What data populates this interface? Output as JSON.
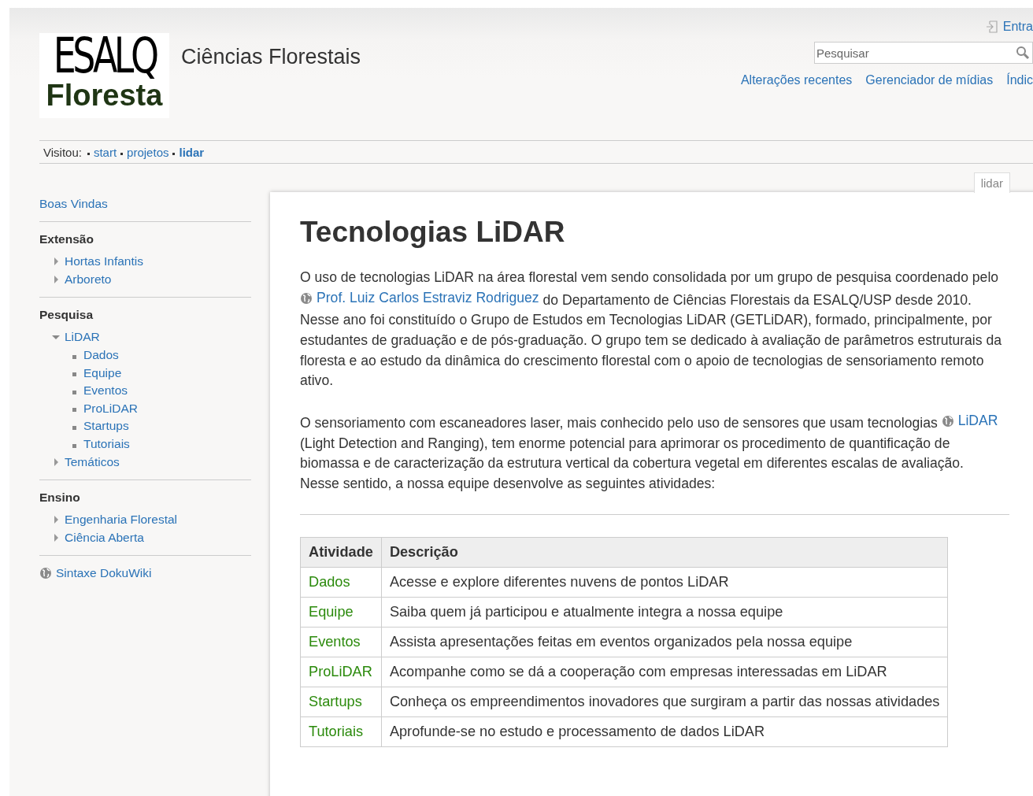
{
  "logo": {
    "line1": "ESALQ",
    "line2": "Floresta"
  },
  "site_title": "Ciências Florestais",
  "user_tools": [
    {
      "label": "Entra"
    }
  ],
  "search": {
    "placeholder": "Pesquisar"
  },
  "site_tools": [
    "Alterações recentes",
    "Gerenciador de mídias",
    "Índic"
  ],
  "breadcrumbs": {
    "label": "Visitou:",
    "items": [
      {
        "label": "start",
        "current": false
      },
      {
        "label": "projetos",
        "current": false
      },
      {
        "label": "lidar",
        "current": true
      }
    ]
  },
  "page_tab": "lidar",
  "sidebar": {
    "top_link": "Boas Vindas",
    "sections": [
      {
        "title": "Extensão",
        "items": [
          {
            "label": "Hortas Infantis",
            "expanded": false
          },
          {
            "label": "Arboreto",
            "expanded": false
          }
        ]
      },
      {
        "title": "Pesquisa",
        "items": [
          {
            "label": "LiDAR",
            "expanded": true,
            "children": [
              {
                "label": "Dados"
              },
              {
                "label": "Equipe"
              },
              {
                "label": "Eventos"
              },
              {
                "label": "ProLiDAR"
              },
              {
                "label": "Startups"
              },
              {
                "label": "Tutoriais"
              }
            ]
          },
          {
            "label": "Temáticos",
            "expanded": false
          }
        ]
      },
      {
        "title": "Ensino",
        "items": [
          {
            "label": "Engenharia Florestal",
            "expanded": false
          },
          {
            "label": "Ciência Aberta",
            "expanded": false
          }
        ]
      }
    ],
    "bottom_link": "Sintaxe DokuWiki"
  },
  "heading": "Tecnologias LiDAR",
  "paragraphs": [
    [
      {
        "kind": "text",
        "text": "O uso de tecnologias LiDAR na área florestal vem sendo consolidada por um grupo de pesquisa coordenado pelo "
      },
      {
        "kind": "external",
        "text": "Prof. Luiz Carlos Estraviz Rodriguez"
      },
      {
        "kind": "text",
        "text": " do Departamento de Ciências Florestais da ESALQ/USP desde 2010. Nesse ano foi constituído o Grupo de Estudos em Tecnologias LiDAR (GETLiDAR), formado, principalmente, por estudantes de graduação e de pós-graduação. O grupo tem se dedicado à avaliação de parâmetros estruturais da floresta e ao estudo da dinâmica do crescimento florestal com o apoio de tecnologias de sensoriamento remoto ativo."
      }
    ],
    [
      {
        "kind": "text",
        "text": "O sensoriamento com escaneadores laser, mais conhecido pelo uso de sensores que usam tecnologias "
      },
      {
        "kind": "external",
        "text": "LiDAR"
      },
      {
        "kind": "text",
        "text": " (Light Detection and Ranging), tem enorme potencial para aprimorar os procedimento de quantificação de biomassa e de caracterização da estrutura vertical da cobertura vegetal em diferentes escalas de avaliação. Nesse sentido, a nossa equipe desenvolve as seguintes atividades:"
      }
    ]
  ],
  "table": {
    "columns": [
      "Atividade",
      "Descrição"
    ],
    "rows": [
      [
        "Dados",
        "Acesse e explore diferentes nuvens de pontos LiDAR"
      ],
      [
        "Equipe",
        "Saiba quem já participou e atualmente integra a nossa equipe"
      ],
      [
        "Eventos",
        "Assista apresentações feitas em eventos organizados pela nossa equipe"
      ],
      [
        "ProLiDAR",
        "Acompanhe como se dá a cooperação com empresas interessadas em LiDAR"
      ],
      [
        "Startups",
        "Conheça os empreendimentos inovadores que surgiram a partir das nossas atividades"
      ],
      [
        "Tutoriais",
        "Aprofunde-se no estudo e processamento de dados LiDAR"
      ]
    ]
  }
}
